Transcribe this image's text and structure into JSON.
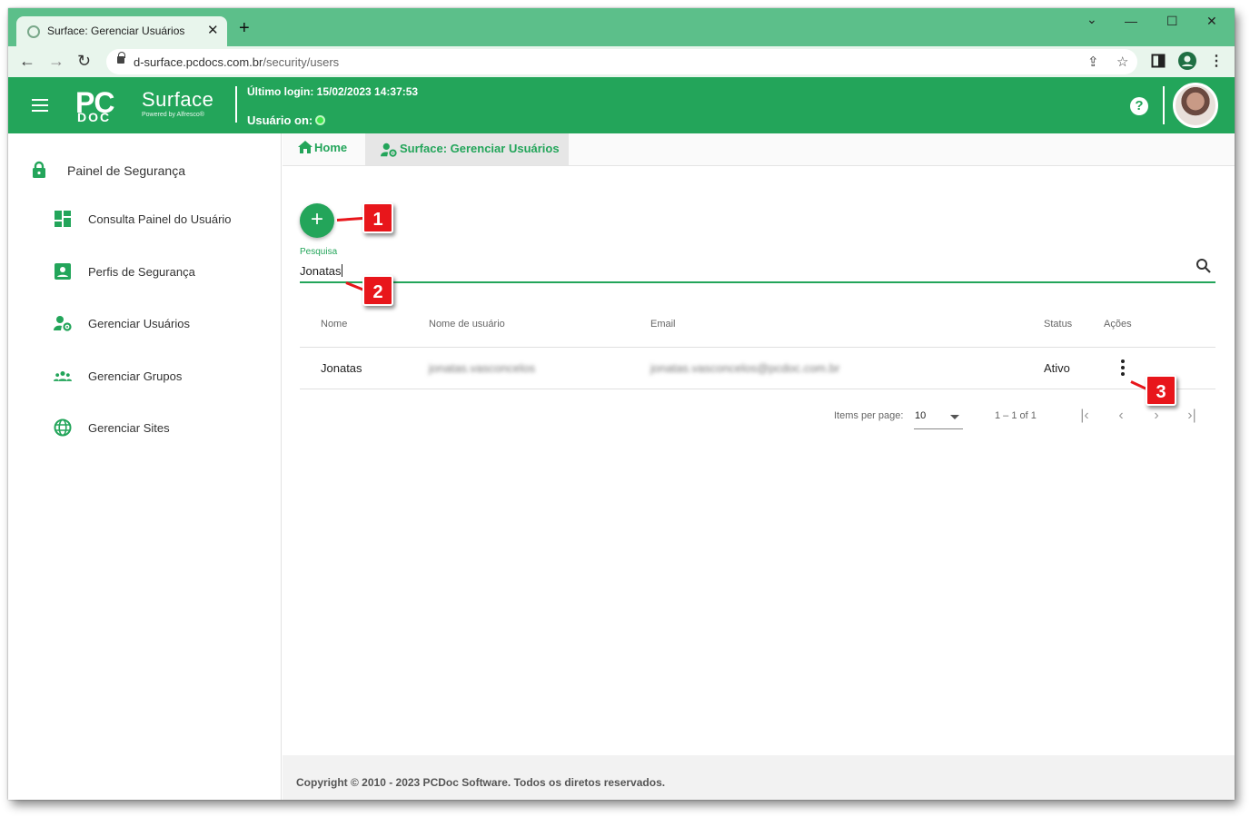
{
  "browser": {
    "tab_title": "Surface: Gerenciar Usuários",
    "tab_close": "✕",
    "new_tab": "+",
    "url_host": "d-surface.pcdocs.com.br",
    "url_path": "/security/users",
    "win_minimize": "—",
    "win_maximize": "☐",
    "win_close": "✕",
    "collapse": "⌄"
  },
  "header": {
    "logo_pc": "PC",
    "logo_doc": "DOC",
    "logo_surface": "Surface",
    "logo_powered": "Powered by Alfresco®",
    "last_login": "Último login: 15/02/2023 14:37:53",
    "user_on": "Usuário on:",
    "help": "?"
  },
  "sidebar": {
    "heading": "Painel de Segurança",
    "items": [
      {
        "label": "Consulta Painel do Usuário",
        "icon": "dashboard-icon"
      },
      {
        "label": "Perfis de Segurança",
        "icon": "profile-card-icon"
      },
      {
        "label": "Gerenciar Usuários",
        "icon": "user-gear-icon"
      },
      {
        "label": "Gerenciar Grupos",
        "icon": "groups-icon"
      },
      {
        "label": "Gerenciar Sites",
        "icon": "globe-icon"
      }
    ]
  },
  "breadcrumb": {
    "home": "Home",
    "current": "Surface: Gerenciar Usuários"
  },
  "main": {
    "add_button": "+",
    "search_label": "Pesquisa",
    "search_value": "Jonatas",
    "columns": [
      "Nome",
      "Nome de usuário",
      "Email",
      "Status",
      "Ações"
    ],
    "rows": [
      {
        "name": "Jonatas",
        "username": "jonatas.vasconcelos",
        "email": "jonatas.vasconcelos@pcdoc.com.br",
        "status": "Ativo"
      }
    ],
    "pager": {
      "items_per_page_label": "Items per page:",
      "items_per_page": "10",
      "range": "1 – 1 of 1",
      "first": "|‹",
      "prev": "‹",
      "next": "›",
      "last": "›|"
    }
  },
  "annotations": [
    "1",
    "2",
    "3"
  ],
  "footer": {
    "copyright": "Copyright © 2010 - 2023 PCDoc Software. Todos os diretos reservados."
  },
  "colors": {
    "brand_green": "#23a55a",
    "tab_strip": "#5cbf8a",
    "callout_red": "#e8161b"
  }
}
